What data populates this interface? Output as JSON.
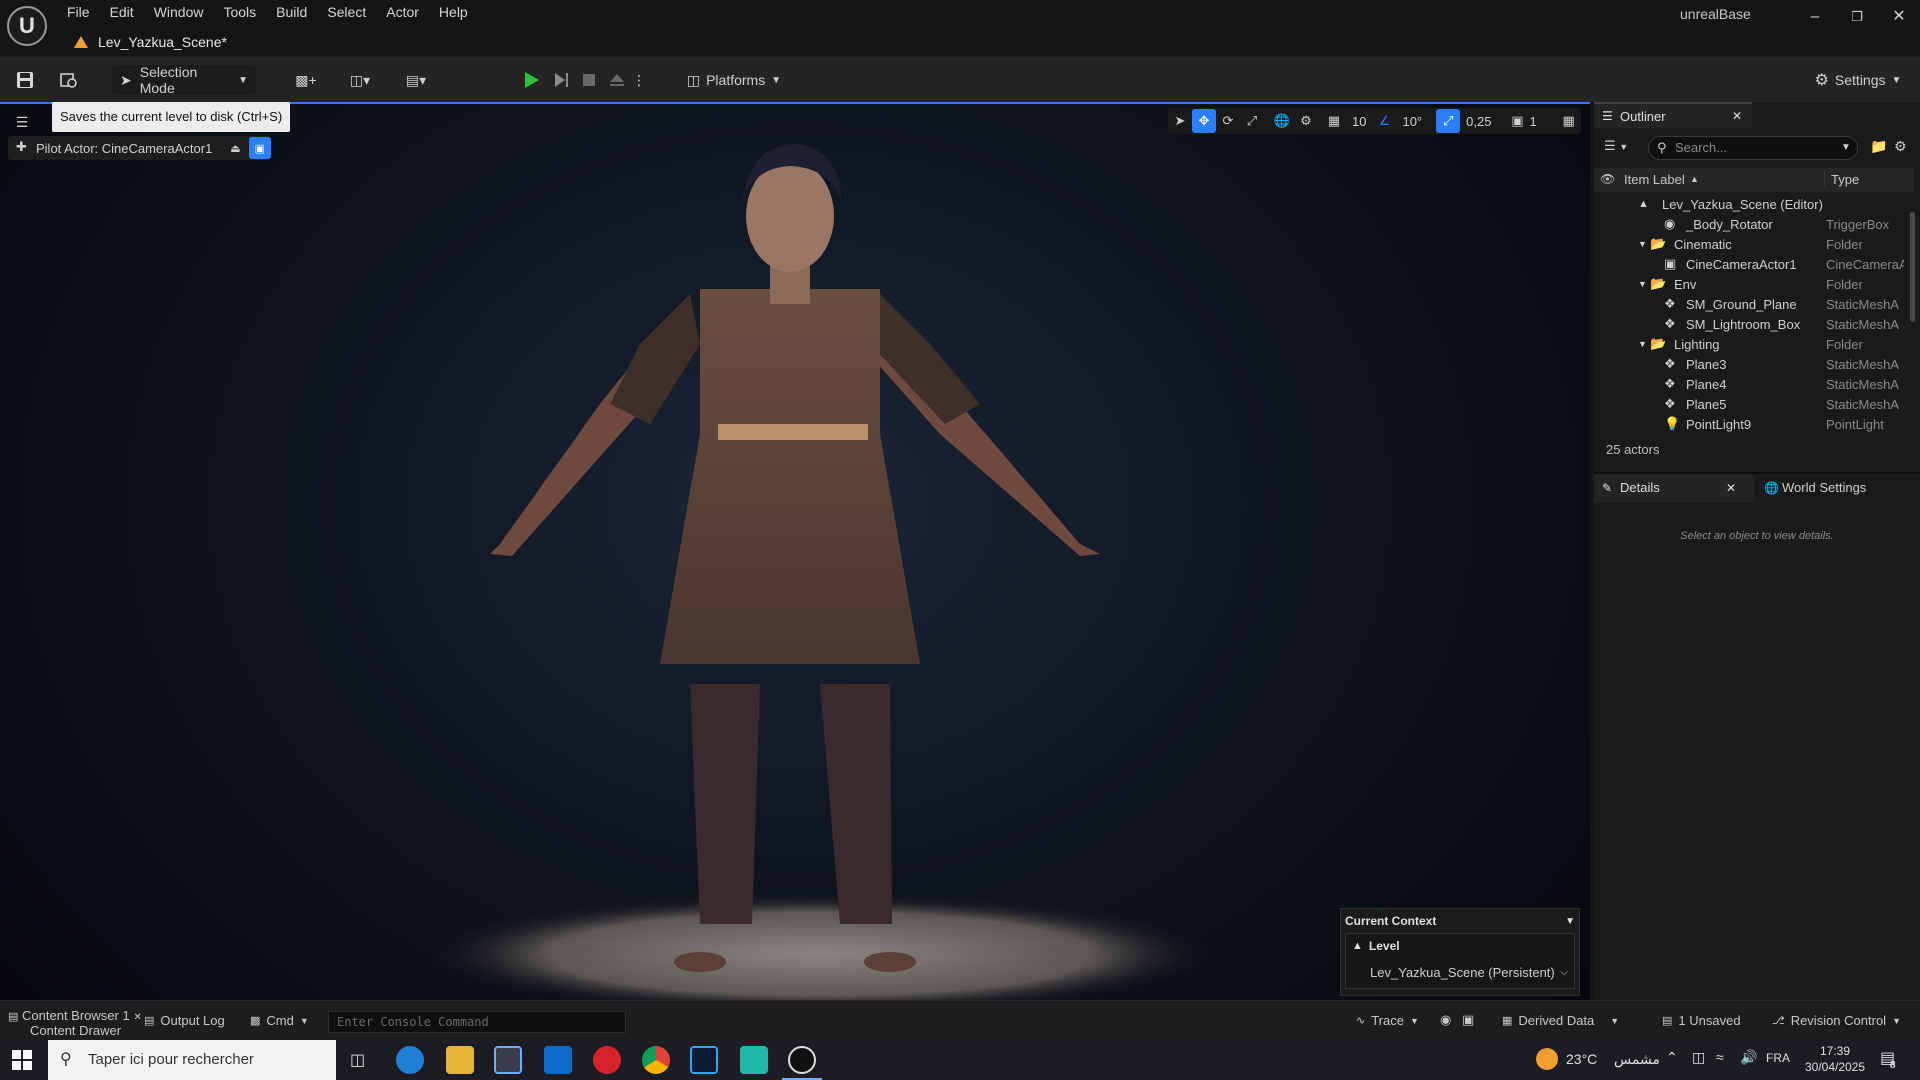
{
  "window": {
    "app_title": "unrealBase",
    "level_tab": "Lev_Yazkua_Scene*"
  },
  "menu": [
    "File",
    "Edit",
    "Window",
    "Tools",
    "Build",
    "Select",
    "Actor",
    "Help"
  ],
  "toolbar": {
    "selection_mode": "Selection Mode",
    "platforms": "Platforms",
    "settings": "Settings"
  },
  "tooltip": "Saves the current level to disk (Ctrl+S)",
  "viewport": {
    "pilot_actor": "Pilot Actor: CineCameraActor1",
    "grid_snap": "10",
    "rotation_snap": "10°",
    "scale_snap": "0,25",
    "camera_speed": "1"
  },
  "context": {
    "title": "Current Context",
    "level_label": "Level",
    "level_value": "Lev_Yazkua_Scene (Persistent)"
  },
  "outliner": {
    "tab": "Outliner",
    "search_placeholder": "Search...",
    "col_label": "Item Label",
    "col_type": "Type",
    "rows": [
      {
        "label": "Lev_Yazkua_Scene (Editor)",
        "type": ""
      },
      {
        "label": "_Body_Rotator",
        "type": "TriggerBox"
      },
      {
        "label": "Cinematic",
        "type": "Folder"
      },
      {
        "label": "CineCameraActor1",
        "type": "CineCameraA"
      },
      {
        "label": "Env",
        "type": "Folder"
      },
      {
        "label": "SM_Ground_Plane",
        "type": "StaticMeshA"
      },
      {
        "label": "SM_Lightroom_Box",
        "type": "StaticMeshA"
      },
      {
        "label": "Lighting",
        "type": "Folder"
      },
      {
        "label": "Plane3",
        "type": "StaticMeshA"
      },
      {
        "label": "Plane4",
        "type": "StaticMeshA"
      },
      {
        "label": "Plane5",
        "type": "StaticMeshA"
      },
      {
        "label": "PointLight9",
        "type": "PointLight"
      }
    ],
    "count": "25 actors"
  },
  "details": {
    "tab": "Details",
    "world_tab": "World Settings",
    "empty": "Select an object to view details."
  },
  "statusbar": {
    "content_browser": "Content Browser 1",
    "content_drawer": "Content Drawer",
    "output_log": "Output Log",
    "cmd": "Cmd",
    "console_placeholder": "Enter Console Command",
    "trace": "Trace",
    "derived_data": "Derived Data",
    "unsaved": "1 Unsaved",
    "revision": "Revision Control"
  },
  "taskbar": {
    "search_placeholder": "Taper ici pour rechercher",
    "weather": "23°C",
    "weather_text": "مشمس",
    "lang": "FRA",
    "time": "17:39",
    "date": "30/04/2025",
    "notif_count": "8"
  },
  "colors": {
    "accent": "#2a7fff",
    "play": "#2fbf3a",
    "warn": "#f0a030"
  }
}
